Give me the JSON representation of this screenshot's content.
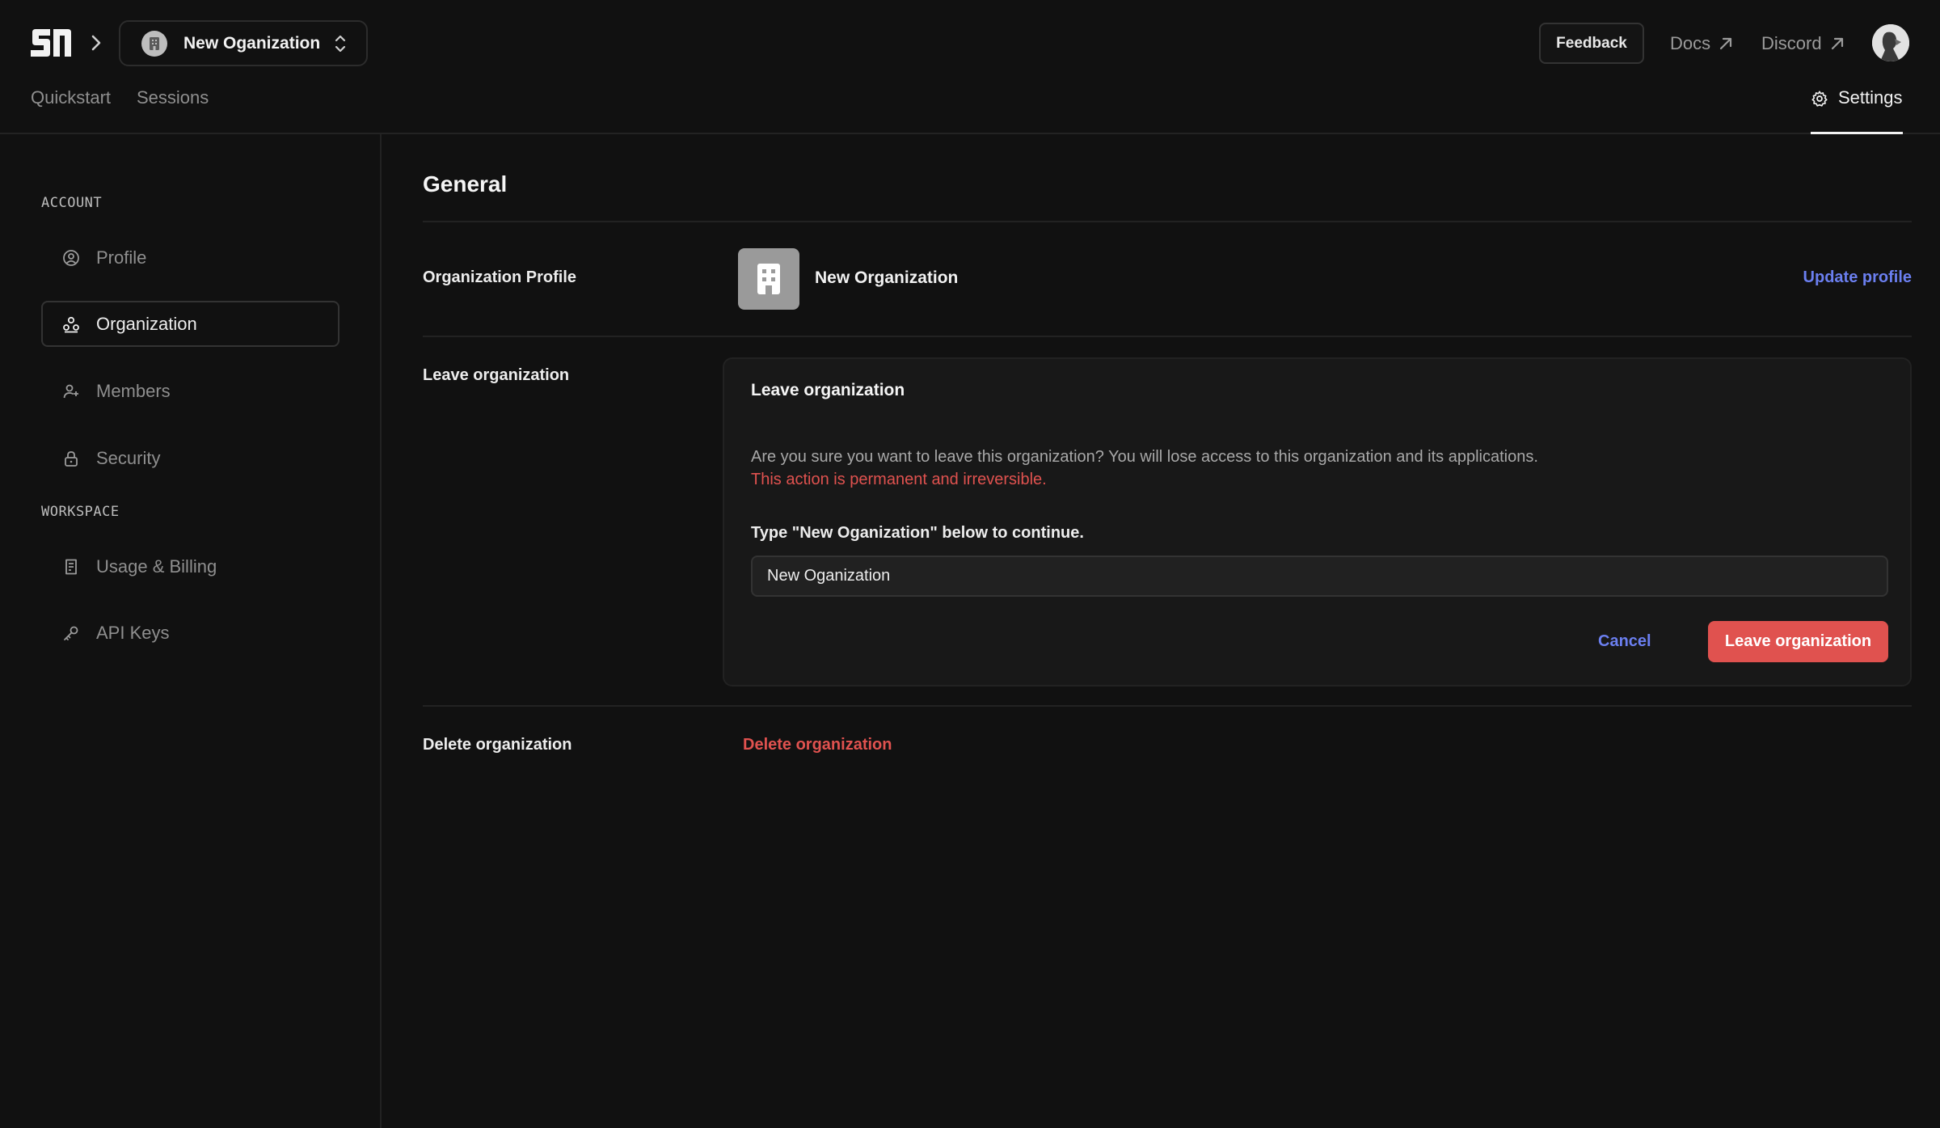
{
  "header": {
    "logo": "logo-icon",
    "org_switcher_name": "New Oganization",
    "feedback_label": "Feedback",
    "docs_label": "Docs",
    "discord_label": "Discord",
    "tabs": [
      {
        "label": "Quickstart"
      },
      {
        "label": "Sessions"
      }
    ],
    "settings_label": "Settings"
  },
  "sidebar": {
    "account_heading": "ACCOUNT",
    "workspace_heading": "WORKSPACE",
    "items": [
      {
        "label": "Profile",
        "icon": "user-circle-icon"
      },
      {
        "label": "Organization",
        "icon": "organization-icon",
        "active": true
      },
      {
        "label": "Members",
        "icon": "user-plus-icon"
      },
      {
        "label": "Security",
        "icon": "lock-icon"
      },
      {
        "label": "Usage & Billing",
        "icon": "receipt-icon"
      },
      {
        "label": "API Keys",
        "icon": "key-icon"
      }
    ]
  },
  "main": {
    "title": "General",
    "org_profile": {
      "label": "Organization Profile",
      "name": "New Organization",
      "update_label": "Update profile"
    },
    "leave": {
      "row_label": "Leave organization",
      "card_title": "Leave organization",
      "description": "Are you sure you want to leave this organization? You will lose access to this organization and its applications.",
      "warning": "This action is permanent and irreversible.",
      "type_prompt": "Type \"New Oganization\" below to continue.",
      "input_value": "New Oganization",
      "cancel_label": "Cancel",
      "confirm_label": "Leave organization"
    },
    "delete": {
      "row_label": "Delete organization",
      "link_label": "Delete organization"
    }
  },
  "colors": {
    "background": "#111111",
    "accent_link": "#6b7ff0",
    "danger": "#e0524f"
  }
}
